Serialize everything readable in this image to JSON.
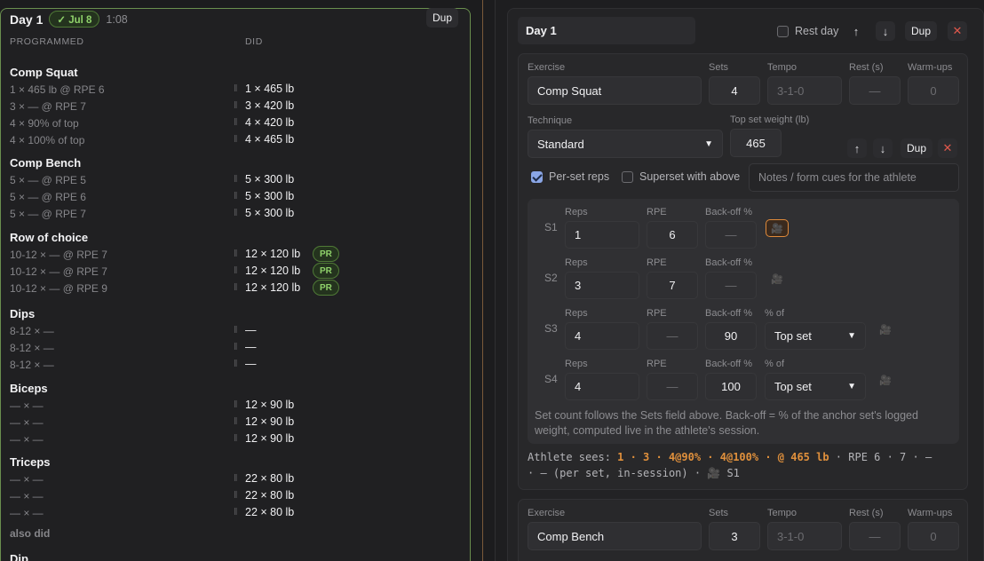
{
  "left": {
    "day": "Day 1",
    "badge": "✓ Jul 8",
    "duration": "1:08",
    "dup": "Dup",
    "col_programmed": "PROGRAMMED",
    "col_did": "DID",
    "bar": "‖",
    "exercises": [
      {
        "name": "Comp Squat",
        "rows": [
          [
            "1 × 465 lb @ RPE 6",
            "1 × 465 lb",
            ""
          ],
          [
            "3 × — @ RPE 7",
            "3 × 420 lb",
            ""
          ],
          [
            "4 × 90% of top",
            "4 × 420 lb",
            ""
          ],
          [
            "4 × 100% of top",
            "4 × 465 lb",
            ""
          ]
        ]
      },
      {
        "name": "Comp Bench",
        "rows": [
          [
            "5 × — @ RPE 5",
            "5 × 300 lb",
            ""
          ],
          [
            "5 × — @ RPE 6",
            "5 × 300 lb",
            ""
          ],
          [
            "5 × — @ RPE 7",
            "5 × 300 lb",
            ""
          ]
        ]
      },
      {
        "name": "Row of choice",
        "rows": [
          [
            "10-12 × — @ RPE 7",
            "12 × 120 lb",
            "PR"
          ],
          [
            "10-12 × — @ RPE 7",
            "12 × 120 lb",
            "PR"
          ],
          [
            "10-12 × — @ RPE 9",
            "12 × 120 lb",
            "PR"
          ]
        ]
      },
      {
        "name": "Dips",
        "rows": [
          [
            "8-12 × —",
            "—",
            ""
          ],
          [
            "8-12 × —",
            "—",
            ""
          ],
          [
            "8-12 × —",
            "—",
            ""
          ]
        ]
      },
      {
        "name": "Biceps",
        "rows": [
          [
            "— × —",
            "12 × 90 lb",
            ""
          ],
          [
            "— × —",
            "12 × 90 lb",
            ""
          ],
          [
            "— × —",
            "12 × 90 lb",
            ""
          ]
        ]
      },
      {
        "name": "Triceps",
        "rows": [
          [
            "— × —",
            "22 × 80 lb",
            ""
          ],
          [
            "— × —",
            "22 × 80 lb",
            ""
          ],
          [
            "— × —",
            "22 × 80 lb",
            ""
          ]
        ]
      }
    ],
    "also_did": "also did",
    "next": "Dip"
  },
  "right": {
    "day_title": "Day 1",
    "rest_day": "Rest day",
    "dup": "Dup",
    "labels": {
      "exercise": "Exercise",
      "sets": "Sets",
      "tempo": "Tempo",
      "rest": "Rest (s)",
      "warmups": "Warm-ups",
      "technique": "Technique",
      "top_set": "Top set weight (lb)",
      "reps": "Reps",
      "rpe": "RPE",
      "backoff": "Back-off %",
      "pct_of": "% of"
    },
    "ex1": {
      "name": "Comp Squat",
      "sets": "4",
      "tempo": "3-1-0",
      "rest": "—",
      "warmups": "0",
      "technique": "Standard",
      "top_set": "465",
      "per_set": "Per-set reps",
      "superset": "Superset with above",
      "notes_ph": "Notes / form cues for the athlete"
    },
    "sets": [
      {
        "label": "S1",
        "reps": "1",
        "rpe": "6",
        "backoff": "—",
        "pctof": ""
      },
      {
        "label": "S2",
        "reps": "3",
        "rpe": "7",
        "backoff": "—",
        "pctof": ""
      },
      {
        "label": "S3",
        "reps": "4",
        "rpe": "—",
        "backoff": "90",
        "pctof": "Top set"
      },
      {
        "label": "S4",
        "reps": "4",
        "rpe": "—",
        "backoff": "100",
        "pctof": "Top set"
      }
    ],
    "note": "Set count follows the Sets field above. Back-off = % of the anchor set's logged weight, computed live in the athlete's session.",
    "sees_prefix": "Athlete sees:",
    "sees_orange": "1 · 3 · 4@90% · 4@100% · @ 465 lb",
    "sees_rest1": " · RPE 6 · 7 · —",
    "sees_line2": "· — (per set, in-session) · 🎥 S1",
    "ex2": {
      "name": "Comp Bench",
      "sets": "3",
      "tempo": "3-1-0",
      "rest": "—",
      "warmups": "0"
    }
  }
}
